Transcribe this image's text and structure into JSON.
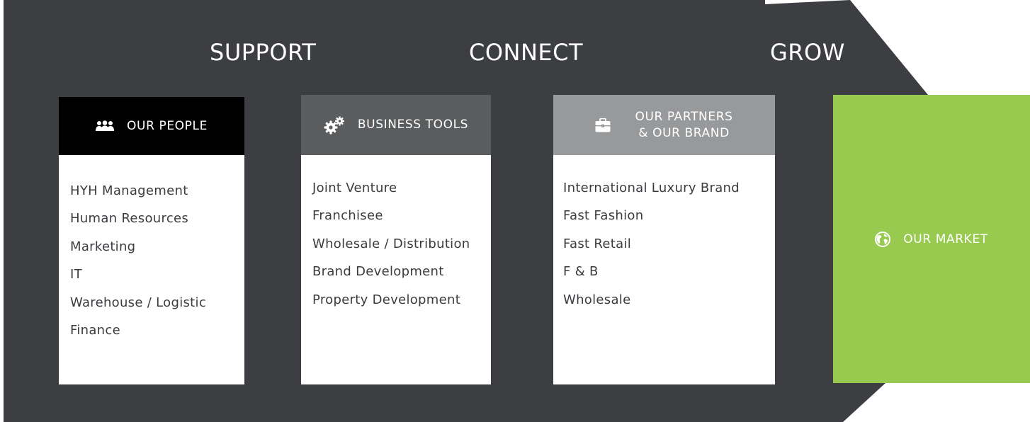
{
  "stages": {
    "support": "SUPPORT",
    "connect": "CONNECT",
    "grow": "GROW"
  },
  "cards": {
    "people": {
      "title": "OUR PEOPLE",
      "icon": "people-icon",
      "items": [
        "HYH Management",
        "Human Resources",
        "Marketing",
        "IT",
        "Warehouse / Logistic",
        "Finance"
      ]
    },
    "tools": {
      "title": "BUSINESS TOOLS",
      "icon": "gears-icon",
      "items": [
        "Joint Venture",
        "Franchisee",
        "Wholesale / Distribution",
        "Brand Development",
        "Property Development"
      ]
    },
    "partners": {
      "title_line1": "OUR PARTNERS",
      "title_line2": "& OUR BRAND",
      "icon": "briefcase-icon",
      "items": [
        "International Luxury Brand",
        "Fast Fashion",
        "Fast Retail",
        "F & B",
        "Wholesale"
      ]
    },
    "market": {
      "title": "OUR MARKET",
      "icon": "globe-icon"
    }
  },
  "colors": {
    "arrow": "#3c3e41",
    "people_header": "#000000",
    "tools_header": "#5a5c5e",
    "partners_header": "#98999b",
    "market": "#97ca4e",
    "text": "#3a3c40"
  }
}
